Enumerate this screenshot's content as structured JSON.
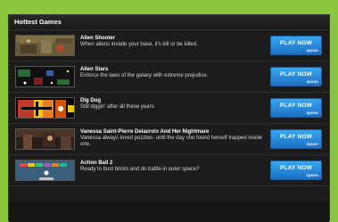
{
  "header": {
    "title": "Hottest Games"
  },
  "games": [
    {
      "title": "Alien Shooter",
      "description": "When aliens invade your base, it's kill or be killed.",
      "button": "PLAY NOW",
      "brand": "spoon"
    },
    {
      "title": "Alien Stars",
      "description": "Enforce the laws of the galaxy with extreme prejudice.",
      "button": "PLAY NOW",
      "brand": "spoon"
    },
    {
      "title": "Dig Dug",
      "description": "Still diggin' after all these years.",
      "button": "PLAY NOW",
      "brand": "spoon"
    },
    {
      "title": "Vanessa Saint-Pierre Delacroix And Her Nightmare",
      "description": "Vanessa always loved puzzles- until the day she found herself trapped inside one.",
      "button": "PLAY NOW",
      "brand": "spoon"
    },
    {
      "title": "Action Ball 2",
      "description": "Ready to bust bricks and do battle in outer space?",
      "button": "PLAY NOW",
      "brand": "spoon"
    }
  ],
  "colors": {
    "accent": "#8cc63f",
    "button": "#2a8ad8",
    "panel": "#1c1c1c"
  }
}
